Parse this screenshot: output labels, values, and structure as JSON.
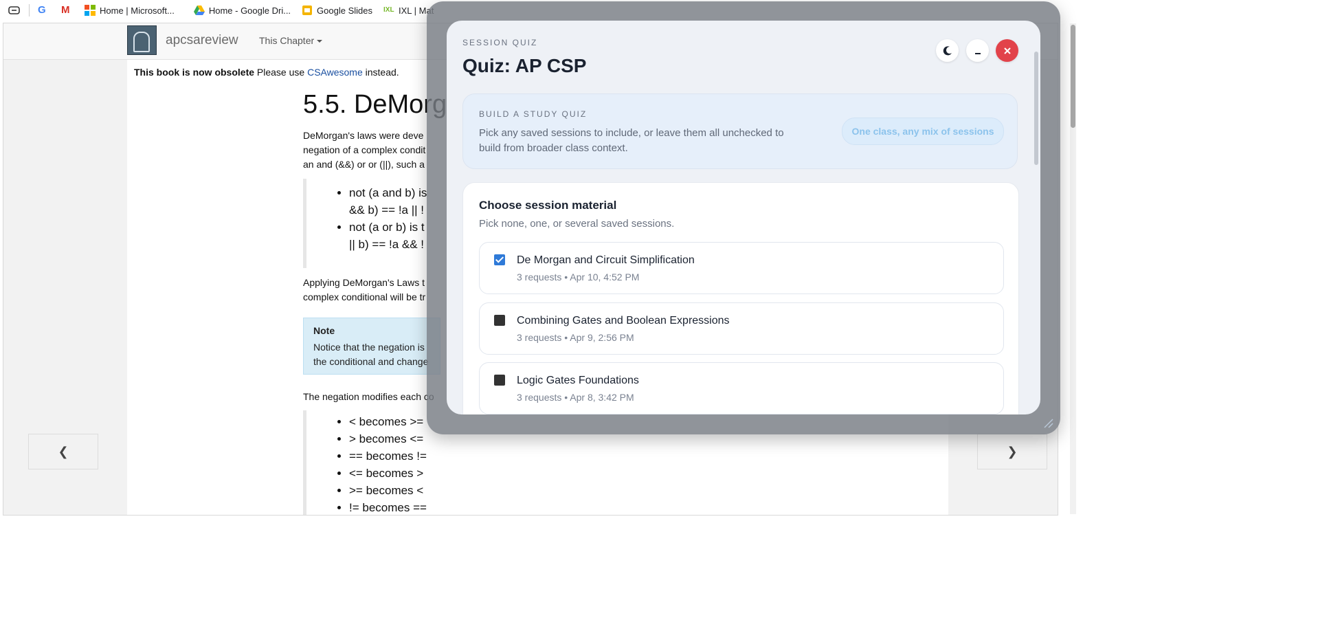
{
  "bookmarks": [
    {
      "label": "Home | Microsoft..."
    },
    {
      "label": "Home - Google Dri..."
    },
    {
      "label": "Google Slides"
    },
    {
      "label": "IXL | Mat"
    }
  ],
  "site": {
    "brand": "apcsareview",
    "chapter_menu": "This Chapter"
  },
  "book": {
    "obsolete_bold": "This book is now obsolete",
    "obsolete_mid": "Please use",
    "obsolete_link": "CSAwesome",
    "obsolete_end": "instead.",
    "heading": "5.5. DeMorg",
    "intro": [
      "DeMorgan's laws were deve",
      "negation of a complex condit",
      "an and (&&) or or (||), such a"
    ],
    "laws": [
      [
        "not (a and b) is",
        "&& b) == !a || !"
      ],
      [
        "not (a or b) is t",
        "|| b) == !a && !"
      ]
    ],
    "applying": [
      "Applying DeMorgan's Laws t",
      "complex conditional will be tr"
    ],
    "note_title": "Note",
    "note_lines": [
      "Notice that the negation is",
      "the conditional and change"
    ],
    "negation_intro": "The negation modifies each co",
    "ops": [
      "< becomes >=",
      "> becomes <=",
      "== becomes !=",
      "<= becomes >",
      ">= becomes <",
      "!= becomes =="
    ]
  },
  "quiz": {
    "eyebrow": "SESSION QUIZ",
    "title": "Quiz: AP CSP",
    "build_label": "BUILD A STUDY QUIZ",
    "build_desc": "Pick any saved sessions to include, or leave them all unchecked to build from broader class context.",
    "pill": "One class, any mix of sessions",
    "material_title": "Choose session material",
    "material_sub": "Pick none, one, or several saved sessions.",
    "sessions": [
      {
        "name": "De Morgan and Circuit Simplification",
        "meta": "3 requests • Apr 10, 4:52 PM",
        "checked": true
      },
      {
        "name": "Combining Gates and Boolean Expressions",
        "meta": "3 requests • Apr 9, 2:56 PM",
        "checked": false
      },
      {
        "name": "Logic Gates Foundations",
        "meta": "3 requests • Apr 8, 3:42 PM",
        "checked": false
      }
    ]
  },
  "icons": {
    "theme": "moon-icon",
    "minimize": "minimize-icon",
    "close": "close-icon",
    "prev": "chevron-left-icon",
    "next": "chevron-right-icon"
  },
  "colors": {
    "close_button": "#e2424a",
    "checkbox_checked": "#2f7ad8",
    "link": "#1a4fa0",
    "note_bg": "#d9edf7"
  }
}
